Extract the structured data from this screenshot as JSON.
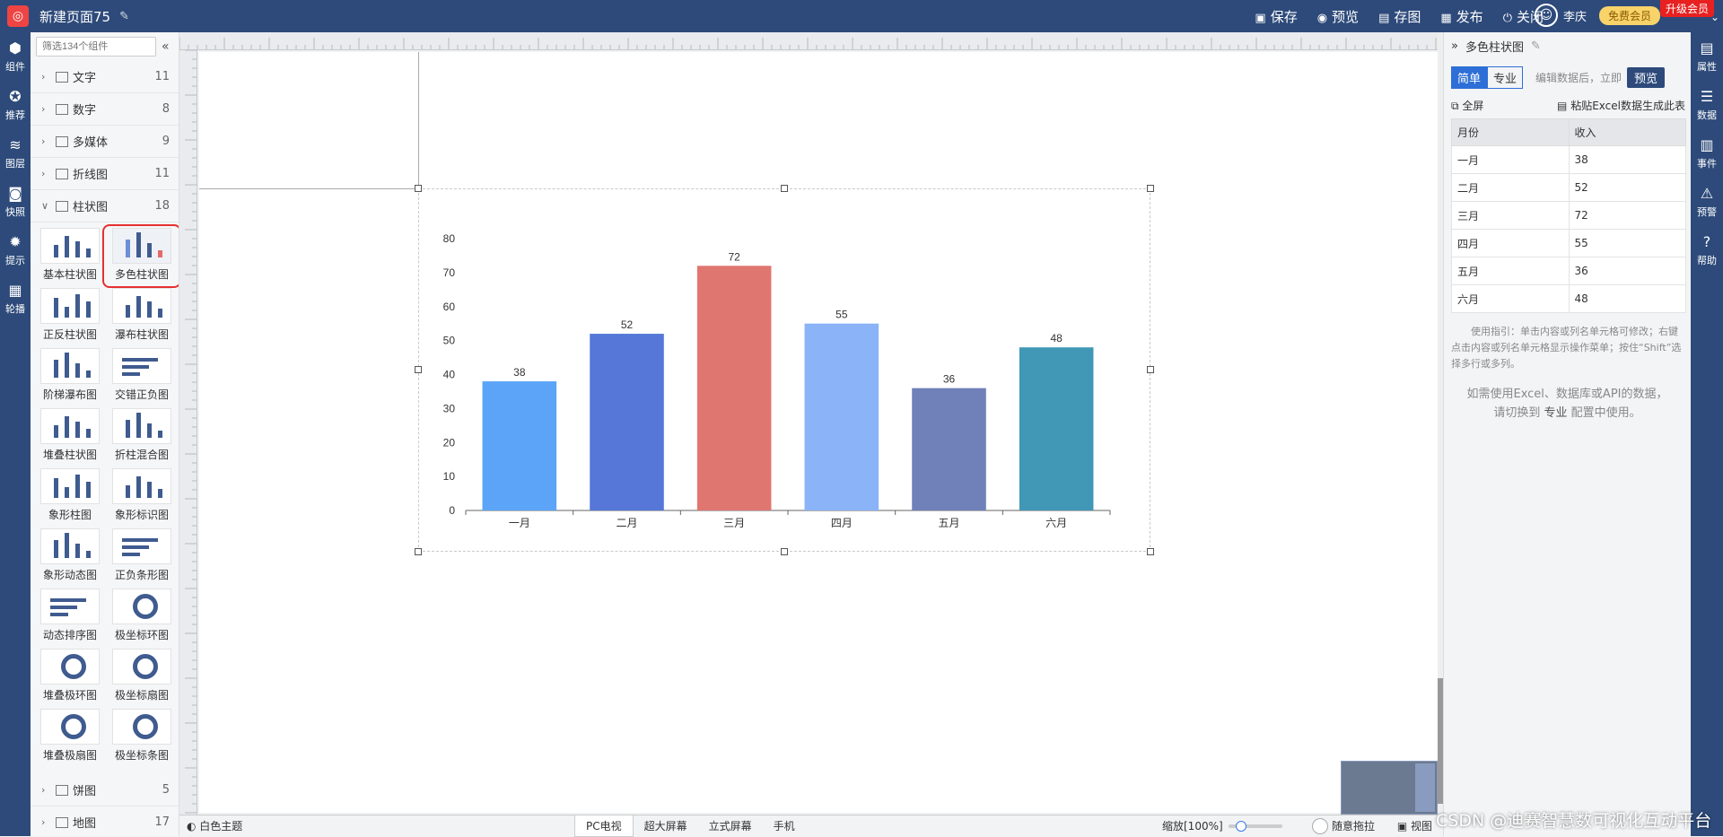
{
  "topbar": {
    "page_title": "新建页面75",
    "save": "保存",
    "preview": "预览",
    "save_as": "存图",
    "publish": "发布",
    "close": "关闭",
    "user": "李庆",
    "vip": "免费会员",
    "upgrade": "升级会员"
  },
  "leftnav": [
    {
      "label": "组件",
      "icon": "cube-icon"
    },
    {
      "label": "推荐",
      "icon": "recommend-icon"
    },
    {
      "label": "图层",
      "icon": "layers-icon"
    },
    {
      "label": "快照",
      "icon": "camera-icon"
    },
    {
      "label": "提示",
      "icon": "lightbulb-icon"
    },
    {
      "label": "轮播",
      "icon": "carousel-icon"
    }
  ],
  "components": {
    "search_placeholder": "筛选134个组件",
    "categories_top": [
      {
        "name": "文字",
        "count": "11"
      },
      {
        "name": "数字",
        "count": "8"
      },
      {
        "name": "多媒体",
        "count": "9"
      },
      {
        "name": "折线图",
        "count": "11"
      },
      {
        "name": "柱状图",
        "count": "18"
      }
    ],
    "items": [
      "基本柱状图",
      "多色柱状图",
      "正反柱状图",
      "瀑布柱状图",
      "阶梯瀑布图",
      "交错正负图",
      "堆叠柱状图",
      "折柱混合图",
      "象形柱图",
      "象形标识图",
      "象形动态图",
      "正负条形图",
      "动态排序图",
      "极坐标环图",
      "堆叠极环图",
      "极坐标扇图",
      "堆叠极扇图",
      "极坐标条图"
    ],
    "categories_bottom": [
      {
        "name": "饼图",
        "count": "5"
      },
      {
        "name": "地图",
        "count": "17"
      }
    ]
  },
  "bottombar": {
    "theme": "白色主题",
    "tabs": [
      "PC电视",
      "超大屏幕",
      "立式屏幕",
      "手机"
    ],
    "zoom": "缩放[100%]",
    "drag": "随意拖拉",
    "view": "视图"
  },
  "rpanel": {
    "title": "多色柱状图",
    "simple": "简单",
    "pro": "专业",
    "hint": "编辑数据后，立即",
    "preview": "预览",
    "fullscreen": "全屏",
    "paste_excel": "粘贴Excel数据生成此表",
    "columns": [
      "月份",
      "收入"
    ],
    "rows": [
      [
        "一月",
        "38"
      ],
      [
        "二月",
        "52"
      ],
      [
        "三月",
        "72"
      ],
      [
        "四月",
        "55"
      ],
      [
        "五月",
        "36"
      ],
      [
        "六月",
        "48"
      ]
    ],
    "usage": "使用指引：单击内容或列名单元格可修改；右键点击内容或列名单元格显示操作菜单；按住“Shift”选择多行或多列。",
    "pro_hint_1": "如需使用Excel、数据库或API的数据，",
    "pro_hint_2a": "请切换到",
    "pro_hint_2b": "专业",
    "pro_hint_2c": "配置中使用。"
  },
  "rightnav": [
    {
      "label": "属性",
      "icon": "properties-icon"
    },
    {
      "label": "数据",
      "icon": "database-icon"
    },
    {
      "label": "事件",
      "icon": "event-icon"
    },
    {
      "label": "预警",
      "icon": "alarm-icon"
    },
    {
      "label": "帮助",
      "icon": "help-icon"
    }
  ],
  "watermark": "CSDN @迪赛智慧数可视化互动平台",
  "chart_data": {
    "type": "bar",
    "categories": [
      "一月",
      "二月",
      "三月",
      "四月",
      "五月",
      "六月"
    ],
    "values": [
      38,
      52,
      72,
      55,
      36,
      48
    ],
    "colors": [
      "#5ba4f8",
      "#5677d8",
      "#e07670",
      "#8ab3f8",
      "#7080b8",
      "#4198b6"
    ],
    "ylim": [
      0,
      80
    ],
    "yticks": [
      0,
      10,
      20,
      30,
      40,
      50,
      60,
      70,
      80
    ],
    "data_labels": true,
    "grid": false
  }
}
